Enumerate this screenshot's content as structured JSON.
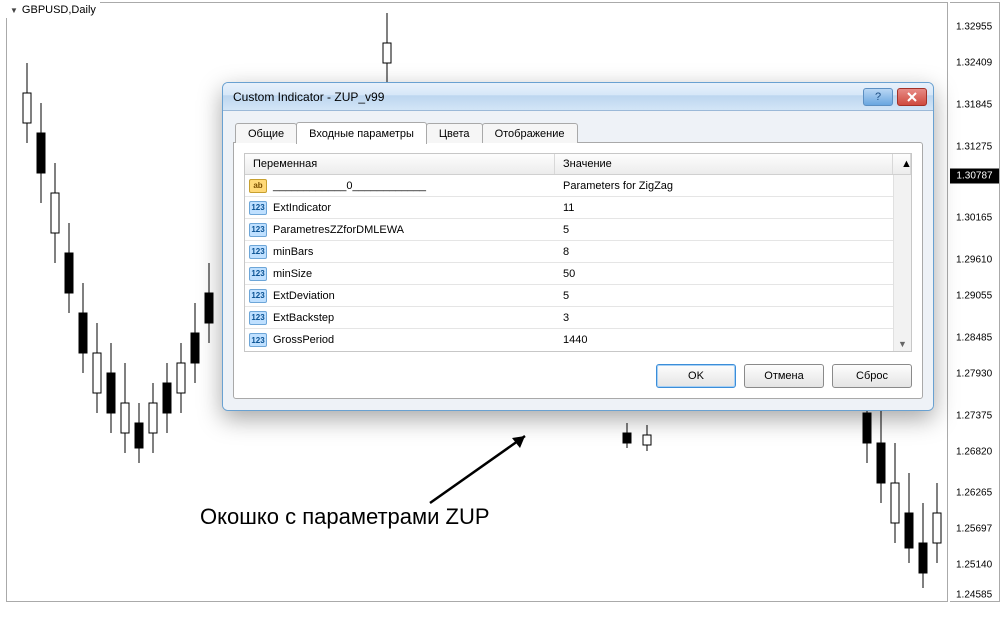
{
  "chart": {
    "symbol": "GBPUSD,Daily",
    "current_price": "1.30787",
    "price_ticks": [
      "1.32955",
      "1.32409",
      "1.31845",
      "1.31275",
      "1.30165",
      "1.29610",
      "1.29055",
      "1.28485",
      "1.27930",
      "1.27375",
      "1.26820",
      "1.26265",
      "1.25697",
      "1.25140",
      "1.24585"
    ]
  },
  "dialog": {
    "title": "Custom Indicator - ZUP_v99",
    "tabs": [
      "Общие",
      "Входные параметры",
      "Цвета",
      "Отображение"
    ],
    "active_tab": 1,
    "columns": {
      "name": "Переменная",
      "value": "Значение"
    },
    "params": [
      {
        "icon": "ab",
        "name": "____________0____________",
        "value": "Parameters for ZigZag"
      },
      {
        "icon": "num",
        "name": "ExtIndicator",
        "value": "11"
      },
      {
        "icon": "num",
        "name": "ParametresZZforDMLEWA",
        "value": "5"
      },
      {
        "icon": "num",
        "name": "minBars",
        "value": "8"
      },
      {
        "icon": "num",
        "name": "minSize",
        "value": "50"
      },
      {
        "icon": "num",
        "name": "ExtDeviation",
        "value": "5"
      },
      {
        "icon": "num",
        "name": "ExtBackstep",
        "value": "3"
      },
      {
        "icon": "num",
        "name": "GrossPeriod",
        "value": "1440"
      }
    ],
    "buttons": {
      "ok": "OK",
      "cancel": "Отмена",
      "reset": "Сброс"
    }
  },
  "annotation": "Окошко с параметрами ZUP"
}
